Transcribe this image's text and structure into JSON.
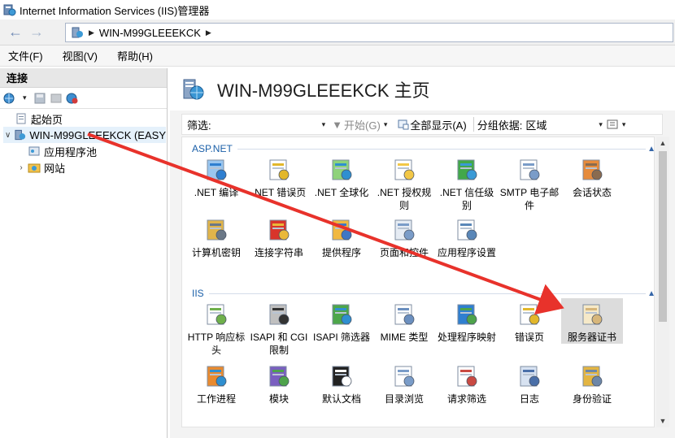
{
  "window": {
    "title": "Internet Information Services (IIS)管理器"
  },
  "address": {
    "crumb": "WIN-M99GLEEEKCK"
  },
  "menu": [
    {
      "label": "文件(F)"
    },
    {
      "label": "视图(V)"
    },
    {
      "label": "帮助(H)"
    }
  ],
  "connections": {
    "header": "连接",
    "tree": [
      {
        "label": "起始页"
      },
      {
        "label": "WIN-M99GLEEEKCK (EASY"
      },
      {
        "label": "应用程序池"
      },
      {
        "label": "网站"
      }
    ]
  },
  "main": {
    "title": "WIN-M99GLEEEKCK 主页",
    "filter": {
      "label": "筛选:",
      "value": "",
      "go_label": "开始(G)",
      "show_all_label": "全部显示(A)",
      "group_by_label": "分组依据:",
      "group_by_value": "区域"
    },
    "groups": [
      {
        "name": "ASP.NET",
        "items": [
          {
            "label": ".NET 编译",
            "icon": "net-compile-icon"
          },
          {
            "label": ".NET 错误页",
            "icon": "error-page-404-icon"
          },
          {
            "label": ".NET 全球化",
            "icon": "globe-icon"
          },
          {
            "label": ".NET 授权规则",
            "icon": "lock-document-icon"
          },
          {
            "label": ".NET 信任级别",
            "icon": "trust-level-icon"
          },
          {
            "label": "SMTP 电子邮件",
            "icon": "smtp-email-icon"
          },
          {
            "label": "会话状态",
            "icon": "session-state-icon"
          },
          {
            "label": "计算机密钥",
            "icon": "machine-key-icon"
          },
          {
            "label": "连接字符串",
            "icon": "connection-string-icon"
          },
          {
            "label": "提供程序",
            "icon": "providers-icon"
          },
          {
            "label": "页面和控件",
            "icon": "pages-controls-icon"
          },
          {
            "label": "应用程序设置",
            "icon": "app-settings-icon"
          }
        ]
      },
      {
        "name": "IIS",
        "items": [
          {
            "label": "HTTP 响应标头",
            "icon": "http-headers-icon"
          },
          {
            "label": "ISAPI 和 CGI 限制",
            "icon": "isapi-cgi-icon"
          },
          {
            "label": "ISAPI 筛选器",
            "icon": "isapi-filter-icon"
          },
          {
            "label": "MIME 类型",
            "icon": "mime-types-icon"
          },
          {
            "label": "处理程序映射",
            "icon": "handler-mappings-icon"
          },
          {
            "label": "错误页",
            "icon": "error-pages-icon"
          },
          {
            "label": "服务器证书",
            "icon": "server-certificate-icon"
          },
          {
            "label": "工作进程",
            "icon": "worker-process-icon"
          },
          {
            "label": "模块",
            "icon": "modules-icon"
          },
          {
            "label": "默认文档",
            "icon": "default-document-icon"
          },
          {
            "label": "目录浏览",
            "icon": "directory-browsing-icon"
          },
          {
            "label": "请求筛选",
            "icon": "request-filtering-icon"
          },
          {
            "label": "日志",
            "icon": "logging-icon"
          },
          {
            "label": "身份验证",
            "icon": "authentication-icon"
          }
        ]
      }
    ]
  },
  "colors": {
    "accent": "#1a5fa8",
    "annotation": "#e8322b",
    "selected": "#dcdcdc"
  }
}
